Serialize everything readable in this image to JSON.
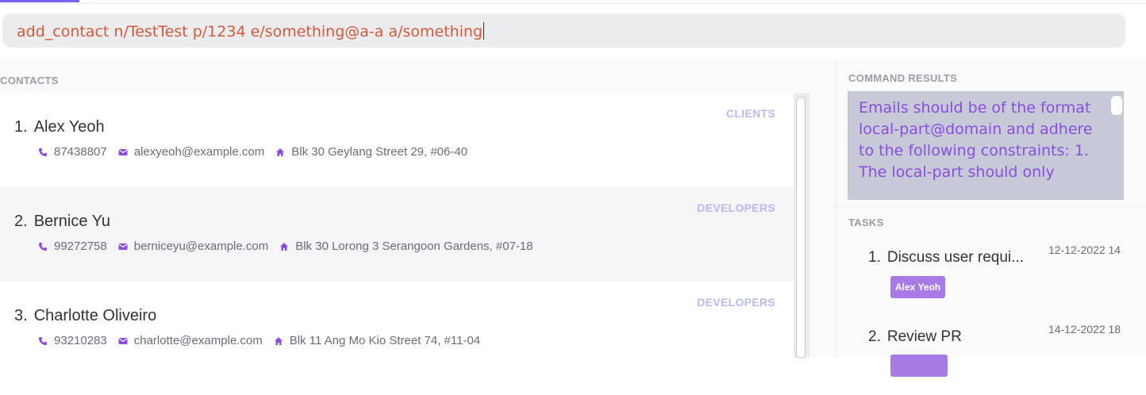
{
  "command": {
    "value": "add_contact n/TestTest p/1234 e/something@a-a a/something"
  },
  "contacts": {
    "label": "CONTACTS",
    "items": [
      {
        "index": "1.",
        "name": "Alex Yeoh",
        "tag": "CLIENTS",
        "phone": "87438807",
        "email": "alexyeoh@example.com",
        "address": "Blk 30 Geylang Street 29, #06-40"
      },
      {
        "index": "2.",
        "name": "Bernice Yu",
        "tag": "DEVELOPERS",
        "phone": "99272758",
        "email": "berniceyu@example.com",
        "address": "Blk 30 Lorong 3 Serangoon Gardens, #07-18"
      },
      {
        "index": "3.",
        "name": "Charlotte Oliveiro",
        "tag": "DEVELOPERS",
        "phone": "93210283",
        "email": "charlotte@example.com",
        "address": "Blk 11 Ang Mo Kio Street 74, #11-04"
      }
    ]
  },
  "results": {
    "label": "COMMAND RESULTS",
    "text": "Emails should be of the format local-part@domain and adhere to the following constraints: 1. The local-part should only"
  },
  "tasks": {
    "label": "TASKS",
    "items": [
      {
        "index": "1.",
        "title": "Discuss user requi...",
        "date": "12-12-2022 14",
        "chip": "Alex Yeoh"
      },
      {
        "index": "2.",
        "title": "Review PR",
        "date": "14-12-2022 18",
        "chip": ""
      }
    ]
  },
  "colors": {
    "accent": "#7b61ff",
    "command_text": "#d05a3c",
    "result_text": "#8a4de0",
    "tag_text": "#b8baf2",
    "chip_bg": "#a77ae6"
  },
  "icons": {
    "phone": "phone-icon",
    "email": "mail-icon",
    "address": "home-icon"
  }
}
